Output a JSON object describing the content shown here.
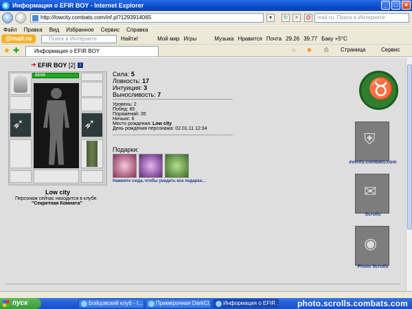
{
  "window": {
    "title": "Информация о EFIR BOY - Internet Explorer"
  },
  "address": {
    "url": "http://lowcity.combats.com/inf.pl?1293914065"
  },
  "mail_search": {
    "placeholder": "mail.ru: Поиск в Интернете"
  },
  "menu": [
    "Файл",
    "Правка",
    "Вид",
    "Избранное",
    "Сервис",
    "Справка"
  ],
  "mailbar": {
    "logo": "@mail.ru",
    "search_placeholder": "Поиск в Интернете",
    "search_button": "Найти!",
    "items": [
      "Мой мир",
      "Игры",
      "Музыка",
      "Нравится",
      "Почта",
      "29.26",
      "39.77",
      "Баку +5°C"
    ]
  },
  "tab": {
    "label": "Информация о EFIR BOY"
  },
  "toolbar": {
    "page": "Страница",
    "tools": "Сервис"
  },
  "character": {
    "nick": "EFIR BOY",
    "level": "[2]",
    "hp": "88/88",
    "location_city": "Low city",
    "location_text": "Персонаж сейчас находится в клубе.",
    "location_room": "\"Секретная Комната\""
  },
  "stats": [
    {
      "label": "Сила:",
      "value": "5"
    },
    {
      "label": "Ловкость:",
      "value": "17"
    },
    {
      "label": "Интуиция:",
      "value": "3"
    },
    {
      "label": "Выносливость:",
      "value": "7"
    }
  ],
  "info": [
    {
      "label": "Уровень:",
      "value": "2"
    },
    {
      "label": "Побед:",
      "value": "85"
    },
    {
      "label": "Поражений:",
      "value": "35"
    },
    {
      "label": "Ничьих:",
      "value": "6"
    },
    {
      "label": "Место рождения:",
      "value": "Low city"
    },
    {
      "label": "День рождения персонажа:",
      "value": "02.01.11 12:34"
    }
  ],
  "gifts": {
    "title": "Подарки:",
    "link": "Нажмите сюда, чтобы увидеть все подарки..."
  },
  "sidebar": {
    "links": [
      "events.combats.com",
      "Scrolls",
      "Photo Scrolls"
    ]
  },
  "taskbar": {
    "start": "пуск",
    "tasks": [
      "Бойцовский клуб - I...",
      "Примерочная DarkCl...",
      "Информация о EFIR ..."
    ]
  },
  "watermark": "photo.scrolls.combats.com",
  "colors": {
    "accent": "#1d3a8a",
    "content_bg": "#dedede",
    "hp": "#1fa81f"
  }
}
